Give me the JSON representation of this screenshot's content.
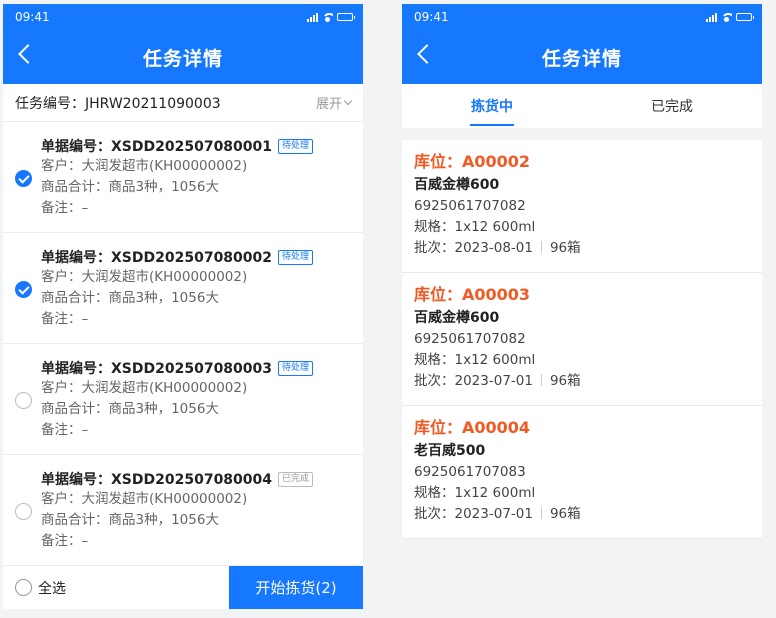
{
  "status": {
    "time": "09:41"
  },
  "left": {
    "title": "任务详情",
    "task_label": "任务编号：",
    "task_no": "JHRW20211090003",
    "expand_label": "展开",
    "orders": [
      {
        "title_label": "单据编号：",
        "no": "XSDD202507080001",
        "badge": "待处理",
        "badge_type": "pending",
        "checked": true,
        "customer": "客户：大润发超市(KH00000002)",
        "goods": "商品合计：商品3种，1056大",
        "note": "备注：–"
      },
      {
        "title_label": "单据编号：",
        "no": "XSDD202507080002",
        "badge": "待处理",
        "badge_type": "pending",
        "checked": true,
        "customer": "客户：大润发超市(KH00000002)",
        "goods": "商品合计：商品3种，1056大",
        "note": "备注：–"
      },
      {
        "title_label": "单据编号：",
        "no": "XSDD202507080003",
        "badge": "待处理",
        "badge_type": "pending",
        "checked": false,
        "customer": "客户：大润发超市(KH00000002)",
        "goods": "商品合计：商品3种，1056大",
        "note": "备注：–"
      },
      {
        "title_label": "单据编号：",
        "no": "XSDD202507080004",
        "badge": "已完成",
        "badge_type": "done",
        "checked": false,
        "customer": "客户：大润发超市(KH00000002)",
        "goods": "商品合计：商品3种，1056大",
        "note": "备注：–"
      }
    ],
    "select_all": "全选",
    "start_button": "开始拣货(2)"
  },
  "right": {
    "title": "任务详情",
    "tabs": [
      {
        "label": "拣货中",
        "active": true
      },
      {
        "label": "已完成",
        "active": false
      }
    ],
    "items": [
      {
        "location": "库位：A00002",
        "name": "百威金樽600",
        "barcode": "6925061707082",
        "spec": "规格：1x12 600ml",
        "batch": "批次：2023-08-01",
        "qty": "96箱"
      },
      {
        "location": "库位：A00003",
        "name": "百威金樽600",
        "barcode": "6925061707082",
        "spec": "规格：1x12 600ml",
        "batch": "批次：2023-07-01",
        "qty": "96箱"
      },
      {
        "location": "库位：A00004",
        "name": "老百威500",
        "barcode": "6925061707083",
        "spec": "规格：1x12 600ml",
        "batch": "批次：2023-07-01",
        "qty": "96箱"
      }
    ]
  },
  "colors": {
    "primary": "#1677ff",
    "location": "#f05a24"
  }
}
